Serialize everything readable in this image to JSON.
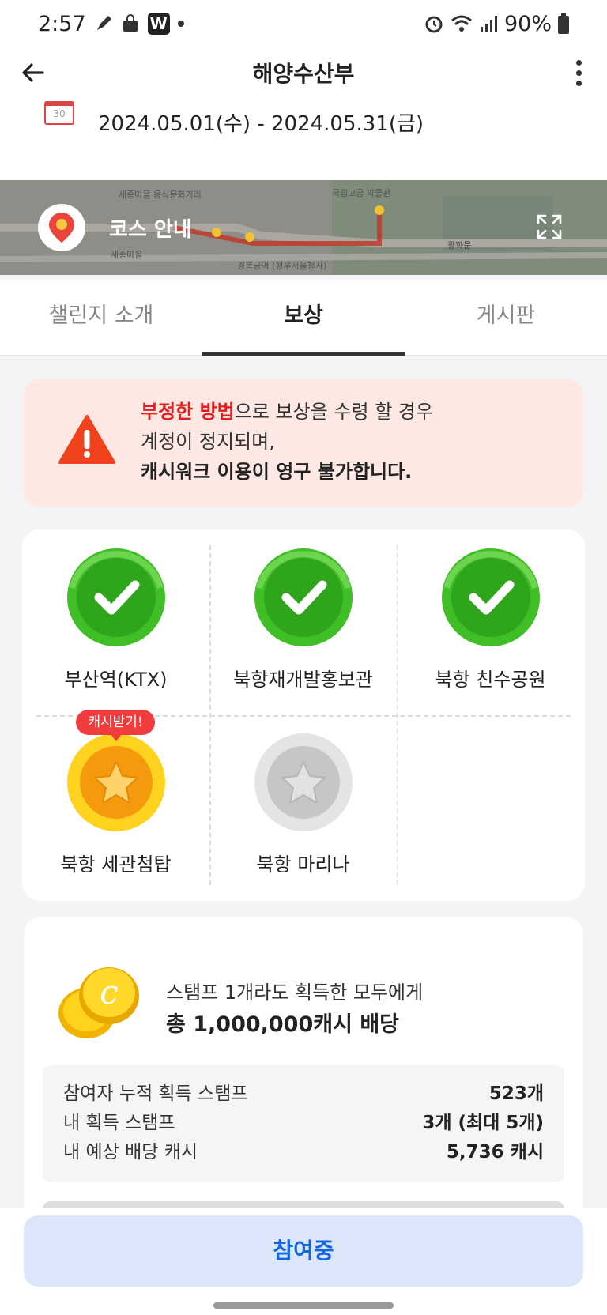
{
  "status": {
    "time": "2:57",
    "battery": "90%",
    "app_badge": "W"
  },
  "header": {
    "title": "해양수산부"
  },
  "period": {
    "calendar_day": "30",
    "text": "2024.05.01(수) - 2024.05.31(금)"
  },
  "course": {
    "label": "코스 안내",
    "map_labels": [
      "세종마을 음식문화거리",
      "국립고궁 박물관",
      "경복궁역 (정부서울청사)",
      "광화문",
      "세종마을"
    ]
  },
  "tabs": [
    {
      "label": "챌린지 소개",
      "active": false
    },
    {
      "label": "보상",
      "active": true
    },
    {
      "label": "게시판",
      "active": false
    }
  ],
  "warning": {
    "line1_red": "부정한 방법",
    "line1_rest": "으로 보상을 수령 할 경우",
    "line2": "계정이 정지되며,",
    "line3": "캐시워크 이용이 영구 불가합니다."
  },
  "stamps": [
    {
      "name": "부산역(KTX)",
      "state": "completed"
    },
    {
      "name": "북항재개발홍보관",
      "state": "completed"
    },
    {
      "name": "북항 친수공원",
      "state": "completed"
    },
    {
      "name": "북항 세관첨탑",
      "state": "claimable",
      "badge": "캐시받기!"
    },
    {
      "name": "북항 마리나",
      "state": "locked"
    }
  ],
  "reward": {
    "subtitle": "스탬프 1개라도 획득한 모두에게",
    "headline": "총 1,000,000캐시 배당",
    "stats": [
      {
        "label": "참여자 누적 획득 스탬프",
        "value": "523개"
      },
      {
        "label": "내 획득 스탬프",
        "value": "3개 (최대 5개)"
      },
      {
        "label": "내 예상 배당 캐시",
        "value": "5,736 캐시"
      }
    ]
  },
  "cta": {
    "label": "참여중"
  },
  "colors": {
    "accent_blue": "#1466e0",
    "warning_red": "#e02020",
    "stamp_green": "#3fbf25",
    "stamp_gold": "#f5b400"
  }
}
